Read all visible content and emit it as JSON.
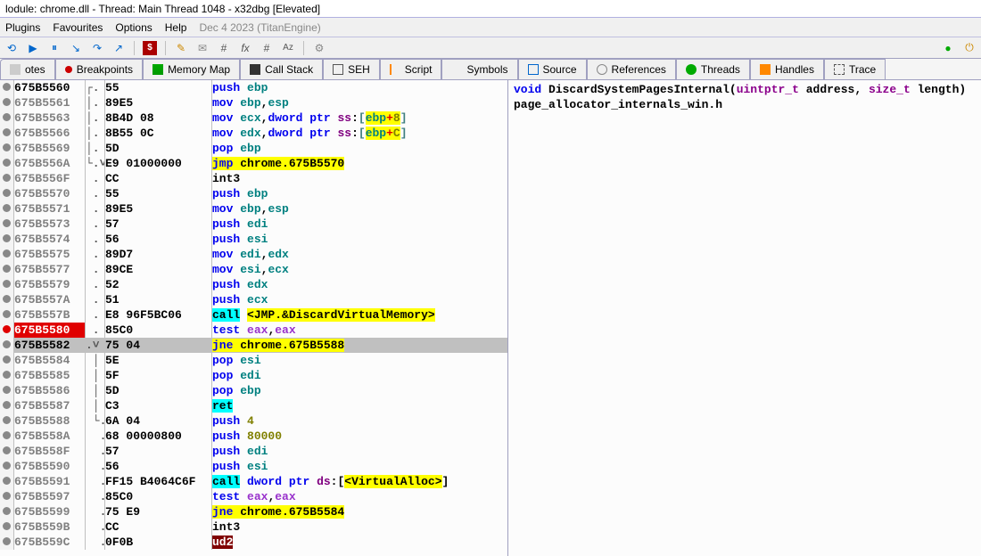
{
  "title": "lodule: chrome.dll - Thread: Main Thread 1048 - x32dbg [Elevated]",
  "menu": {
    "plugins": "Plugins",
    "fav": "Favourites",
    "options": "Options",
    "help": "Help",
    "status": "Dec 4 2023 (TitanEngine)"
  },
  "tabs": {
    "notes": "otes",
    "bp": "Breakpoints",
    "mem": "Memory Map",
    "call": "Call Stack",
    "seh": "SEH",
    "script": "Script",
    "sym": "Symbols",
    "src": "Source",
    "ref": "References",
    "thr": "Threads",
    "han": "Handles",
    "trc": "Trace"
  },
  "source": {
    "sig_html": "<span class='c-kw'>void</span> <span class='c-id'>DiscardSystemPagesInternal</span><span class='c-pun'>(</span><span class='c-type'>uintptr_t</span> <span class='c-id'>address</span><span class='c-pun'>,</span> <span class='c-type'>size_t</span> <span class='c-id'>length</span><span class='c-pun'>)</span>",
    "file": "page_allocator_internals_win.h"
  },
  "rows": [
    {
      "bp": "grey",
      "addr": "675B5560",
      "addrCls": "func",
      "flow": "┌.",
      "bytes": "55",
      "asm": "<span class='i-mn'>push</span> <span class='i-reg'>ebp</span>"
    },
    {
      "bp": "grey",
      "addr": "675B5561",
      "flow": "│.",
      "bytes": "89E5",
      "asm": "<span class='i-mn'>mov</span> <span class='i-reg'>ebp</span>,<span class='i-reg'>esp</span>"
    },
    {
      "bp": "grey",
      "addr": "675B5563",
      "flow": "│.",
      "bytes": "8B4D 08",
      "asm": "<span class='i-mn'>mov</span> <span class='i-reg'>ecx</span>,<span class='i-mn'>dword ptr</span> <span class='i-seg'>ss</span>:<span class='brkt'>[</span><span class='hl-yellow'><span class='i-reg'>ebp</span><span class='txt-red'>+</span><span class='i-imm'>8</span></span><span class='brkt'>]</span>"
    },
    {
      "bp": "grey",
      "addr": "675B5566",
      "flow": "│.",
      "bytes": "8B55 0C",
      "asm": "<span class='i-mn'>mov</span> <span class='i-reg'>edx</span>,<span class='i-mn'>dword ptr</span> <span class='i-seg'>ss</span>:<span class='brkt'>[</span><span class='hl-yellow'><span class='i-reg'>ebp</span><span class='txt-red'>+</span><span class='i-imm'>C</span></span><span class='brkt'>]</span>"
    },
    {
      "bp": "grey",
      "addr": "675B5569",
      "flow": "│.",
      "bytes": "5D",
      "asm": "<span class='i-mn'>pop</span> <span class='i-reg'>ebp</span>"
    },
    {
      "bp": "grey",
      "addr": "675B556A",
      "flow": "└.˅",
      "bytes": "E9 01000000",
      "asm": "<span class='hl-yellow'><span class='i-mn'>jmp</span> <span class='i-dk'>chrome.675B5570</span></span>"
    },
    {
      "bp": "grey",
      "addr": "675B556F",
      "flow": " .",
      "bytes": "CC",
      "asm": "<span class='i-dk'>int3</span>"
    },
    {
      "bp": "grey",
      "addr": "675B5570",
      "flow": " .",
      "bytes": "55",
      "asm": "<span class='i-mn'>push</span> <span class='i-reg'>ebp</span>"
    },
    {
      "bp": "grey",
      "addr": "675B5571",
      "flow": " .",
      "bytes": "89E5",
      "asm": "<span class='i-mn'>mov</span> <span class='i-reg'>ebp</span>,<span class='i-reg'>esp</span>"
    },
    {
      "bp": "grey",
      "addr": "675B5573",
      "flow": " .",
      "bytes": "57",
      "asm": "<span class='i-mn'>push</span> <span class='i-reg'>edi</span>"
    },
    {
      "bp": "grey",
      "addr": "675B5574",
      "flow": " .",
      "bytes": "56",
      "asm": "<span class='i-mn'>push</span> <span class='i-reg'>esi</span>"
    },
    {
      "bp": "grey",
      "addr": "675B5575",
      "flow": " .",
      "bytes": "89D7",
      "asm": "<span class='i-mn'>mov</span> <span class='i-reg'>edi</span>,<span class='i-reg'>edx</span>"
    },
    {
      "bp": "grey",
      "addr": "675B5577",
      "flow": " .",
      "bytes": "89CE",
      "asm": "<span class='i-mn'>mov</span> <span class='i-reg'>esi</span>,<span class='i-reg'>ecx</span>"
    },
    {
      "bp": "grey",
      "addr": "675B5579",
      "flow": " .",
      "bytes": "52",
      "asm": "<span class='i-mn'>push</span> <span class='i-reg'>edx</span>"
    },
    {
      "bp": "grey",
      "addr": "675B557A",
      "flow": " .",
      "bytes": "51",
      "asm": "<span class='i-mn'>push</span> <span class='i-reg'>ecx</span>"
    },
    {
      "bp": "grey",
      "addr": "675B557B",
      "flow": " .",
      "bytes": "E8 96F5BC06",
      "asm": "<span class='hl-cyan i-mn'>call</span> <span class='call-targ'>&lt;JMP.&amp;DiscardVirtualMemory&gt;</span>"
    },
    {
      "bp": "red",
      "addr": "675B5580",
      "addrCls": "bpset",
      "flow": " .",
      "bytes": "85C0",
      "asm": "<span class='i-mn'>test</span> <span class='i-regh'>eax</span>,<span class='i-regh'>eax</span>"
    },
    {
      "sel": true,
      "bp": "grey",
      "addr": "675B5582",
      "flow": ".˅",
      "bytes": "75 04",
      "asm": "<span class='hl-yellow'><span class='i-mn'>jne</span> <span class='i-dk'>chrome.675B5588</span></span>"
    },
    {
      "bp": "grey",
      "addr": "675B5584",
      "flow": " │",
      "bytes": "5E",
      "asm": "<span class='i-mn'>pop</span> <span class='i-reg'>esi</span>"
    },
    {
      "bp": "grey",
      "addr": "675B5585",
      "flow": " │",
      "bytes": "5F",
      "asm": "<span class='i-mn'>pop</span> <span class='i-reg'>edi</span>"
    },
    {
      "bp": "grey",
      "addr": "675B5586",
      "flow": " │",
      "bytes": "5D",
      "asm": "<span class='i-mn'>pop</span> <span class='i-reg'>ebp</span>"
    },
    {
      "bp": "grey",
      "addr": "675B5587",
      "flow": " │",
      "bytes": "C3",
      "asm": "<span class='hl-cyan i-mn'>ret</span>"
    },
    {
      "bp": "grey",
      "addr": "675B5588",
      "flow": " └.",
      "bytes": "6A 04",
      "asm": "<span class='i-mn'>push</span> <span class='i-imm'>4</span>"
    },
    {
      "bp": "grey",
      "addr": "675B558A",
      "flow": "  .",
      "bytes": "68 00000800",
      "asm": "<span class='i-mn'>push</span> <span class='i-imm'>80000</span>"
    },
    {
      "bp": "grey",
      "addr": "675B558F",
      "flow": "  .",
      "bytes": "57",
      "asm": "<span class='i-mn'>push</span> <span class='i-reg'>edi</span>"
    },
    {
      "bp": "grey",
      "addr": "675B5590",
      "flow": "  .",
      "bytes": "56",
      "asm": "<span class='i-mn'>push</span> <span class='i-reg'>esi</span>"
    },
    {
      "bp": "grey",
      "addr": "675B5591",
      "flow": "  .",
      "bytes": "FF15 B4064C6F",
      "asm": "<span class='hl-cyan i-mn'>call</span> <span class='i-mn'>dword ptr</span> <span class='i-seg'>ds</span>:[<span class='call-targ'>&lt;VirtualAlloc&gt;</span>]"
    },
    {
      "bp": "grey",
      "addr": "675B5597",
      "flow": "  .",
      "bytes": "85C0",
      "asm": "<span class='i-mn'>test</span> <span class='i-regh'>eax</span>,<span class='i-regh'>eax</span>"
    },
    {
      "bp": "grey",
      "addr": "675B5599",
      "flow": "  .˄",
      "bytes": "75 E9",
      "asm": "<span class='hl-yellow'><span class='i-mn'>jne</span> <span class='i-dk'>chrome.675B5584</span></span>"
    },
    {
      "bp": "grey",
      "addr": "675B559B",
      "flow": "  .",
      "bytes": "CC",
      "asm": "<span class='i-dk'>int3</span>"
    },
    {
      "bp": "grey",
      "addr": "675B559C",
      "flow": "  .",
      "bytes": "0F0B",
      "asm": "<span class='hl-darkred'>ud2</span>"
    }
  ]
}
